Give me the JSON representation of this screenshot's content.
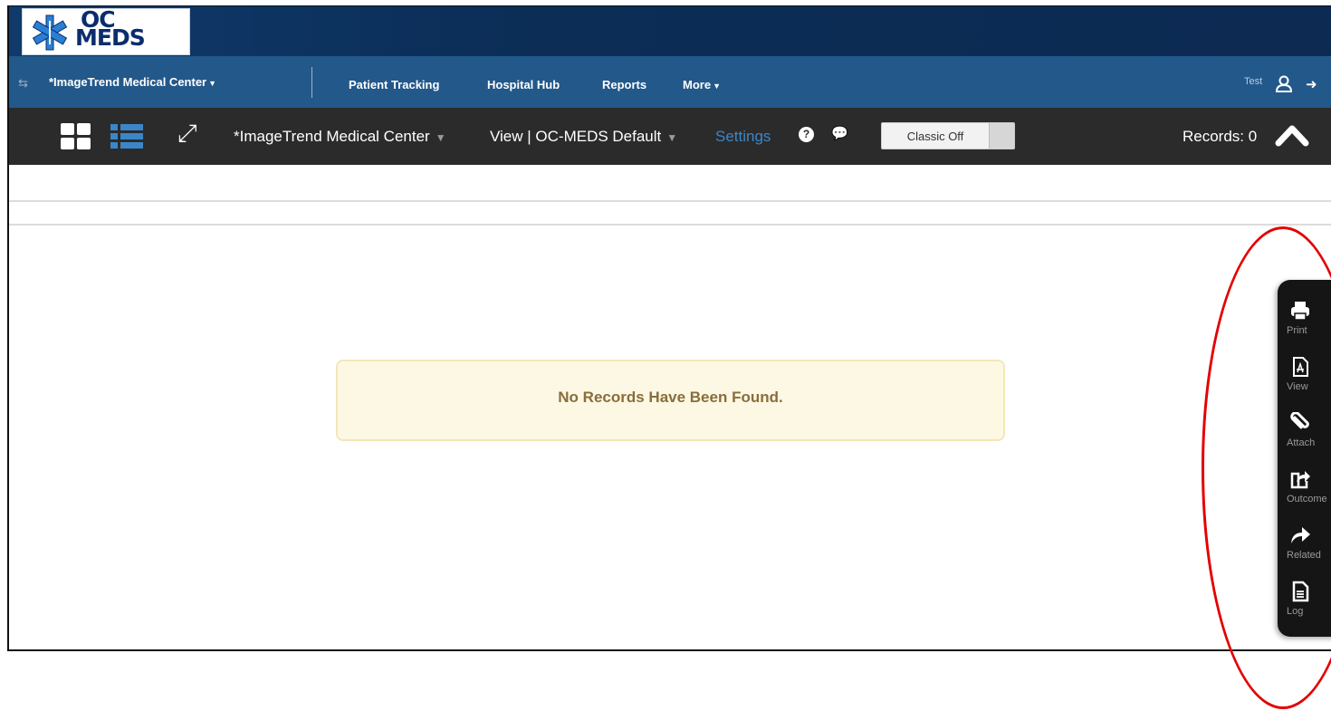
{
  "brand": {
    "logo_top": "OC",
    "logo_bottom": "MEDS"
  },
  "nav": {
    "org_label": "*ImageTrend Medical Center",
    "links": [
      {
        "label": "Patient Tracking"
      },
      {
        "label": "Hospital Hub"
      },
      {
        "label": "Reports"
      },
      {
        "label": "More"
      }
    ],
    "user_name": "Test"
  },
  "toolbar": {
    "org_label": "*ImageTrend Medical Center",
    "view_label": "View | OC-MEDS Default",
    "settings_label": "Settings",
    "classic_toggle_label": "Classic Off",
    "records_label": "Records: 0"
  },
  "content": {
    "empty_message": "No Records Have Been Found."
  },
  "actions": [
    {
      "label": "Print",
      "icon": "print-icon"
    },
    {
      "label": "View",
      "icon": "pdf-icon"
    },
    {
      "label": "Attach",
      "icon": "paperclip-icon"
    },
    {
      "label": "Outcome",
      "icon": "share-icon"
    },
    {
      "label": "Related",
      "icon": "forward-arrow-icon"
    },
    {
      "label": "Log",
      "icon": "document-icon"
    }
  ],
  "colors": {
    "brand_bar": "#0c2a52",
    "nav_bar": "#23588a",
    "toolbar": "#2b2b2b",
    "settings_link": "#3b86c8",
    "alert_bg": "#fcf8e3",
    "annotation_red": "#e30000"
  }
}
